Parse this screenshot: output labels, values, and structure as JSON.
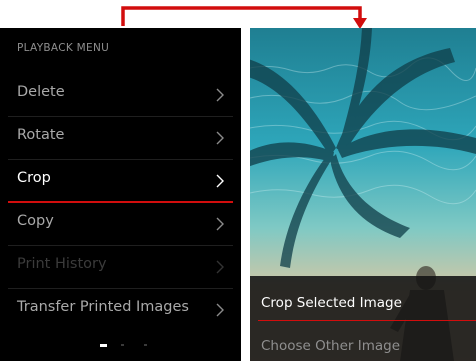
{
  "colors": {
    "accent_red": "#d20d0d",
    "panel_bg": "#000000",
    "water": "#2aa0b5",
    "sand": "#d6c3a0"
  },
  "playback_menu": {
    "header": "PLAYBACK MENU",
    "items": [
      {
        "label": "Delete",
        "state": "normal",
        "icon": "chevron-right-icon"
      },
      {
        "label": "Rotate",
        "state": "normal",
        "icon": "chevron-right-icon"
      },
      {
        "label": "Crop",
        "state": "selected",
        "icon": "chevron-right-icon"
      },
      {
        "label": "Copy",
        "state": "normal",
        "icon": "chevron-right-icon"
      },
      {
        "label": "Print History",
        "state": "disabled",
        "icon": "chevron-right-icon"
      },
      {
        "label": "Transfer Printed Images",
        "state": "normal",
        "icon": "chevron-right-icon"
      }
    ],
    "pagination": {
      "pages": 3,
      "current": 1
    }
  },
  "crop_submenu": {
    "options": [
      {
        "label": "Crop Selected Image",
        "state": "selected"
      },
      {
        "label": "Choose Other Image",
        "state": "normal"
      }
    ]
  },
  "navigation_arrow": {
    "icon": "red-flow-arrow-icon"
  }
}
